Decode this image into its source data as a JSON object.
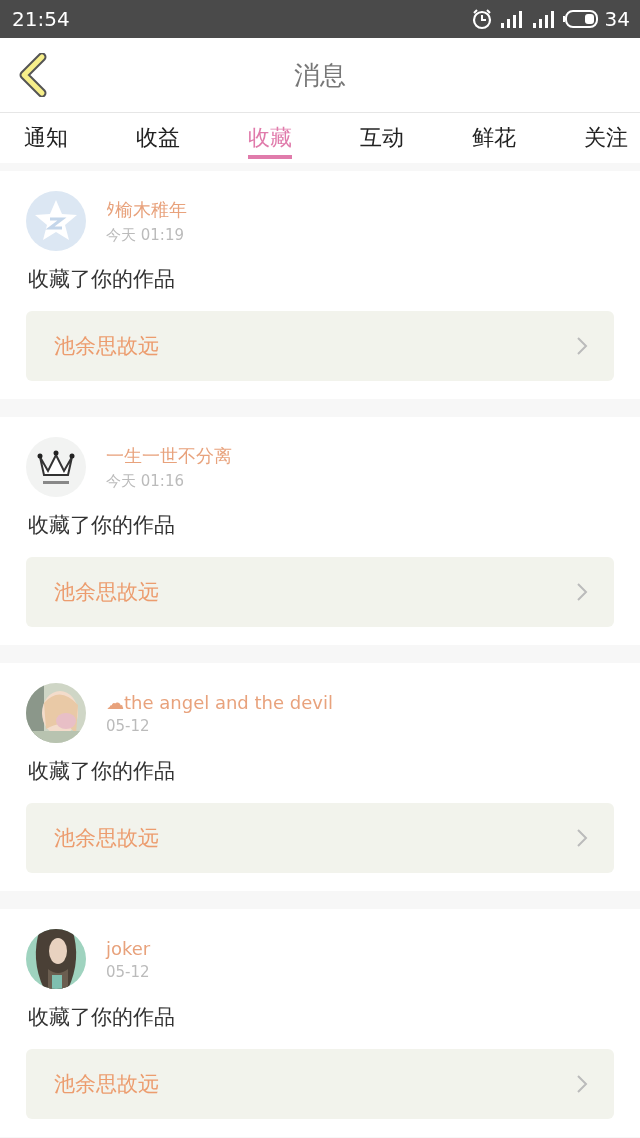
{
  "status_bar": {
    "time": "21:54",
    "battery": "34"
  },
  "header": {
    "title": "消息"
  },
  "tabs": [
    {
      "label": "通知",
      "selected": false
    },
    {
      "label": "收益",
      "selected": false
    },
    {
      "label": "收藏",
      "selected": true
    },
    {
      "label": "互动",
      "selected": false
    },
    {
      "label": "鲜花",
      "selected": false
    },
    {
      "label": "关注",
      "selected": false
    }
  ],
  "messages": [
    {
      "kind": "star",
      "user": "ﾀ榆木稚年",
      "time": "今天 01:19",
      "text": "收藏了你的作品",
      "work": "池余思故远"
    },
    {
      "kind": "crown",
      "user": "一生一世不分离",
      "time": "今天 01:16",
      "text": "收藏了你的作品",
      "work": "池余思故远"
    },
    {
      "kind": "photo_light",
      "user": "☁the angel and the devil",
      "time": "05-12",
      "text": "收藏了你的作品",
      "work": "池余思故远"
    },
    {
      "kind": "photo_dark",
      "user": "joker",
      "time": "05-12",
      "text": "收藏了你的作品",
      "work": "池余思故远"
    }
  ]
}
